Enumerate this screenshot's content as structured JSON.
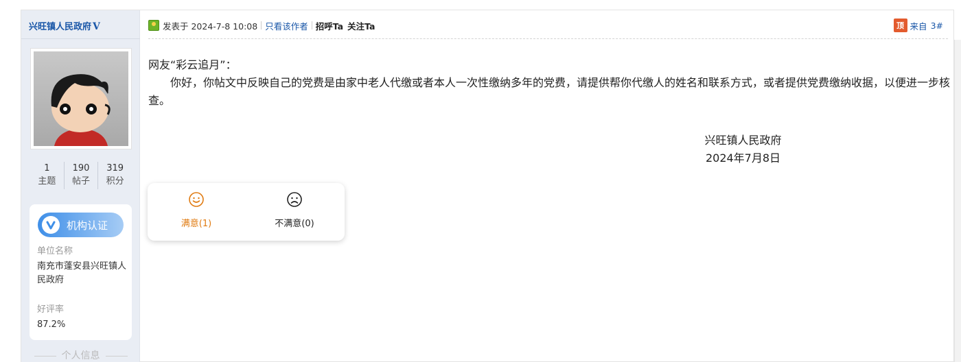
{
  "user": {
    "name": "兴旺镇人民政府",
    "verified_mark": "V",
    "stats": [
      {
        "value": "1",
        "label": "主题"
      },
      {
        "value": "190",
        "label": "帖子"
      },
      {
        "value": "319",
        "label": "积分"
      }
    ],
    "cert": {
      "badge": "机构认证",
      "unit_label": "单位名称",
      "unit_value": "南充市蓬安县兴旺镇人民政府",
      "rating_label": "好评率",
      "rating_value": "87.2%"
    },
    "personal_info": "个人信息"
  },
  "post": {
    "posted_at": "发表于 2024-7-8 10:08",
    "author_only": "只看该作者",
    "greet": "招呼Ta",
    "follow": "关注Ta",
    "top_icon": "顶",
    "from": "来自",
    "floor": "3#",
    "greeting": "网友“彩云追月”：",
    "body": "你好，你帖文中反映自己的党费是由家中老人代缴或者本人一次性缴纳多年的党费，请提供帮你代缴人的姓名和联系方式，或者提供党费缴纳收据，以便进一步核查。",
    "signature_org": "兴旺镇人民政府",
    "signature_date": "2024年7月8日"
  },
  "rating": {
    "satisfied": "满意(1)",
    "unsatisfied": "不满意(0)",
    "satisfied_color": "#e07b12"
  }
}
